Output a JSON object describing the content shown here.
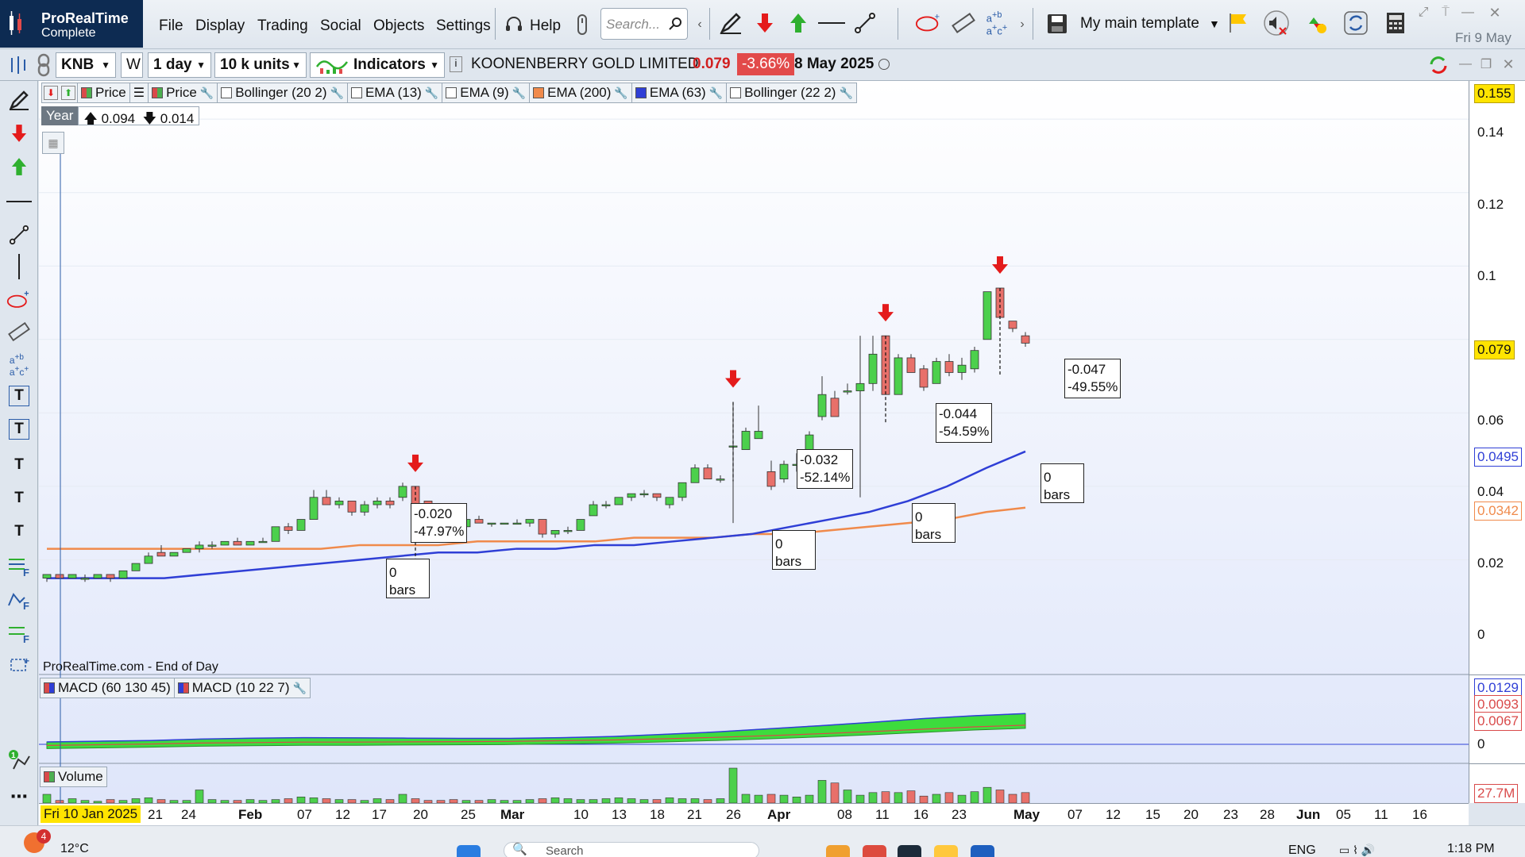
{
  "app": {
    "brand_name": "ProRealTime",
    "brand_sub": "Complete"
  },
  "menu": [
    "File",
    "Display",
    "Trading",
    "Social",
    "Objects",
    "Settings",
    "Help"
  ],
  "search": {
    "placeholder": "Search..."
  },
  "template": {
    "label": "My main template"
  },
  "top_date": "Fri 9 May",
  "toolbar2": {
    "ticker": "KNB",
    "w_label": "W",
    "period": "1 day",
    "units": "10 k units",
    "indicators": "Indicators",
    "instrument_name": "KOONENBERRY GOLD LIMITED",
    "last_price": "0.079",
    "change_pct": "-3.66%",
    "date": "8 May 2025"
  },
  "legend": [
    {
      "label": "Price",
      "color": "#d94a4a"
    },
    {
      "label": "Price",
      "color": "#4caf50"
    },
    {
      "label": "Bollinger (20 2)",
      "color": "#ffffff"
    },
    {
      "label": "EMA (13)",
      "color": "#ffffff"
    },
    {
      "label": "EMA (9)",
      "color": "#ffffff"
    },
    {
      "label": "EMA (200)",
      "color": "#f08a4b"
    },
    {
      "label": "EMA (63)",
      "color": "#2f3fd6"
    },
    {
      "label": "Bollinger (22 2)",
      "color": "#ffffff"
    }
  ],
  "year_box": {
    "label": "Year",
    "high": "0.094",
    "low": "0.014"
  },
  "source": "ProRealTime.com - End of Day",
  "y_axis": {
    "ticks": [
      "0.14",
      "0.12",
      "0.1",
      "0.06",
      "0.04",
      "0.02",
      "0"
    ],
    "badges": [
      {
        "value": "0.155",
        "bg": "#ffe400",
        "fg": "#111"
      },
      {
        "value": "0.079",
        "bg": "#ffe400",
        "fg": "#111"
      },
      {
        "value": "0.0495",
        "bg": "#ffffff",
        "fg": "#2f3fd6"
      },
      {
        "value": "0.0342",
        "bg": "#ffffff",
        "fg": "#f08a4b"
      }
    ],
    "macd_badges": [
      {
        "value": "0.0129",
        "fg": "#2f3fd6"
      },
      {
        "value": "0.0093",
        "fg": "#d94a4a"
      },
      {
        "value": "0.0067",
        "fg": "#d94a4a"
      }
    ],
    "macd_zero": "0",
    "vol_badge": "27.7M"
  },
  "annotations": [
    {
      "change": "-0.020",
      "pct": "-47.97%",
      "bars": "0 bars"
    },
    {
      "change": "-0.032",
      "pct": "-52.14%",
      "bars": "0 bars"
    },
    {
      "change": "-0.044",
      "pct": "-54.59%",
      "bars": "0 bars"
    },
    {
      "change": "-0.047",
      "pct": "-49.55%",
      "bars": "0 bars"
    }
  ],
  "macd_legend": [
    {
      "label": "MACD (60 130 45)",
      "color": "#d94a4a"
    },
    {
      "label": "MACD (10 22 7)",
      "color": "#2f3fd6"
    }
  ],
  "volume_legend": {
    "label": "Volume",
    "color": "#4caf50"
  },
  "x_axis": {
    "start": "Fri 10 Jan 2025",
    "ticks": [
      {
        "label": "21"
      },
      {
        "label": "24"
      },
      {
        "label": "Feb",
        "month": true
      },
      {
        "label": "07"
      },
      {
        "label": "12"
      },
      {
        "label": "17"
      },
      {
        "label": "20"
      },
      {
        "label": "25"
      },
      {
        "label": "Mar",
        "month": true
      },
      {
        "label": "10"
      },
      {
        "label": "13"
      },
      {
        "label": "18"
      },
      {
        "label": "21"
      },
      {
        "label": "26"
      },
      {
        "label": "Apr",
        "month": true
      },
      {
        "label": "08"
      },
      {
        "label": "11"
      },
      {
        "label": "16"
      },
      {
        "label": "23"
      },
      {
        "label": "May",
        "month": true
      },
      {
        "label": "07"
      },
      {
        "label": "12"
      },
      {
        "label": "15"
      },
      {
        "label": "20"
      },
      {
        "label": "23"
      },
      {
        "label": "28"
      },
      {
        "label": "Jun",
        "month": true
      },
      {
        "label": "05"
      },
      {
        "label": "11"
      },
      {
        "label": "16"
      }
    ]
  },
  "taskbar": {
    "weather_badge": "4",
    "temperature": "12°C",
    "search": "Search",
    "language": "ENG",
    "time": "1:18 PM"
  },
  "chart_data": {
    "type": "candlestick",
    "title": "KOONENBERRY GOLD LIMITED",
    "ylim": [
      0,
      0.155
    ],
    "ohlc": [
      [
        0.015,
        0.016,
        0.014,
        0.016
      ],
      [
        0.016,
        0.016,
        0.015,
        0.015
      ],
      [
        0.015,
        0.016,
        0.015,
        0.016
      ],
      [
        0.015,
        0.016,
        0.014,
        0.015
      ],
      [
        0.015,
        0.016,
        0.015,
        0.016
      ],
      [
        0.016,
        0.016,
        0.014,
        0.015
      ],
      [
        0.015,
        0.017,
        0.015,
        0.017
      ],
      [
        0.017,
        0.019,
        0.017,
        0.019
      ],
      [
        0.019,
        0.022,
        0.019,
        0.021
      ],
      [
        0.022,
        0.024,
        0.021,
        0.021
      ],
      [
        0.021,
        0.022,
        0.021,
        0.022
      ],
      [
        0.022,
        0.023,
        0.022,
        0.023
      ],
      [
        0.023,
        0.025,
        0.022,
        0.024
      ],
      [
        0.024,
        0.025,
        0.023,
        0.024
      ],
      [
        0.024,
        0.025,
        0.024,
        0.025
      ],
      [
        0.025,
        0.026,
        0.024,
        0.024
      ],
      [
        0.024,
        0.025,
        0.024,
        0.025
      ],
      [
        0.025,
        0.026,
        0.025,
        0.025
      ],
      [
        0.025,
        0.029,
        0.025,
        0.029
      ],
      [
        0.029,
        0.03,
        0.027,
        0.028
      ],
      [
        0.028,
        0.031,
        0.028,
        0.031
      ],
      [
        0.031,
        0.039,
        0.031,
        0.037
      ],
      [
        0.037,
        0.039,
        0.035,
        0.035
      ],
      [
        0.035,
        0.037,
        0.034,
        0.036
      ],
      [
        0.036,
        0.036,
        0.032,
        0.033
      ],
      [
        0.033,
        0.036,
        0.032,
        0.035
      ],
      [
        0.035,
        0.037,
        0.034,
        0.036
      ],
      [
        0.036,
        0.037,
        0.034,
        0.035
      ],
      [
        0.037,
        0.041,
        0.036,
        0.04
      ],
      [
        0.04,
        0.04,
        0.03,
        0.032
      ],
      [
        0.036,
        0.036,
        0.032,
        0.032
      ],
      [
        0.032,
        0.033,
        0.031,
        0.031
      ],
      [
        0.031,
        0.033,
        0.029,
        0.029
      ],
      [
        0.029,
        0.031,
        0.029,
        0.031
      ],
      [
        0.031,
        0.032,
        0.03,
        0.03
      ],
      [
        0.03,
        0.03,
        0.029,
        0.03
      ],
      [
        0.03,
        0.03,
        0.03,
        0.03
      ],
      [
        0.03,
        0.031,
        0.03,
        0.03
      ],
      [
        0.03,
        0.031,
        0.029,
        0.031
      ],
      [
        0.031,
        0.031,
        0.026,
        0.027
      ],
      [
        0.027,
        0.028,
        0.026,
        0.028
      ],
      [
        0.028,
        0.029,
        0.027,
        0.028
      ],
      [
        0.028,
        0.031,
        0.028,
        0.031
      ],
      [
        0.032,
        0.036,
        0.032,
        0.035
      ],
      [
        0.035,
        0.036,
        0.034,
        0.035
      ],
      [
        0.035,
        0.037,
        0.035,
        0.037
      ],
      [
        0.037,
        0.038,
        0.036,
        0.038
      ],
      [
        0.038,
        0.039,
        0.037,
        0.038
      ],
      [
        0.038,
        0.038,
        0.036,
        0.037
      ],
      [
        0.035,
        0.037,
        0.034,
        0.037
      ],
      [
        0.037,
        0.041,
        0.036,
        0.041
      ],
      [
        0.041,
        0.046,
        0.041,
        0.045
      ],
      [
        0.045,
        0.046,
        0.042,
        0.042
      ],
      [
        0.042,
        0.043,
        0.041,
        0.042
      ],
      [
        0.051,
        0.063,
        0.03,
        0.051
      ],
      [
        0.05,
        0.056,
        0.05,
        0.055
      ],
      [
        0.053,
        0.062,
        0.053,
        0.055
      ],
      [
        0.044,
        0.047,
        0.039,
        0.04
      ],
      [
        0.042,
        0.047,
        0.041,
        0.046
      ],
      [
        0.046,
        0.049,
        0.044,
        0.046
      ],
      [
        0.048,
        0.055,
        0.047,
        0.054
      ],
      [
        0.059,
        0.07,
        0.058,
        0.065
      ],
      [
        0.064,
        0.066,
        0.059,
        0.059
      ],
      [
        0.066,
        0.068,
        0.065,
        0.066
      ],
      [
        0.066,
        0.081,
        0.037,
        0.068
      ],
      [
        0.068,
        0.081,
        0.066,
        0.076
      ],
      [
        0.081,
        0.081,
        0.065,
        0.065
      ],
      [
        0.065,
        0.076,
        0.065,
        0.075
      ],
      [
        0.075,
        0.076,
        0.071,
        0.071
      ],
      [
        0.072,
        0.073,
        0.066,
        0.067
      ],
      [
        0.068,
        0.075,
        0.068,
        0.074
      ],
      [
        0.074,
        0.076,
        0.07,
        0.071
      ],
      [
        0.071,
        0.075,
        0.069,
        0.073
      ],
      [
        0.072,
        0.078,
        0.071,
        0.077
      ],
      [
        0.08,
        0.093,
        0.08,
        0.093
      ],
      [
        0.094,
        0.094,
        0.086,
        0.086
      ],
      [
        0.085,
        0.085,
        0.082,
        0.083
      ],
      [
        0.081,
        0.082,
        0.078,
        0.079
      ]
    ],
    "ema63": [
      0.015,
      0.015,
      0.015,
      0.015,
      0.016,
      0.017,
      0.018,
      0.019,
      0.02,
      0.021,
      0.022,
      0.022,
      0.023,
      0.023,
      0.024,
      0.024,
      0.025,
      0.026,
      0.027,
      0.029,
      0.031,
      0.033,
      0.036,
      0.04,
      0.045,
      0.0495
    ],
    "ema200": [
      0.023,
      0.023,
      0.023,
      0.023,
      0.023,
      0.023,
      0.023,
      0.023,
      0.024,
      0.024,
      0.024,
      0.025,
      0.025,
      0.025,
      0.025,
      0.026,
      0.026,
      0.026,
      0.027,
      0.027,
      0.028,
      0.029,
      0.03,
      0.031,
      0.033,
      0.0342
    ],
    "macd_fill_top": [
      0.001,
      0.0013,
      0.0016,
      0.0022,
      0.0026,
      0.0028,
      0.0027,
      0.0026,
      0.0025,
      0.0025,
      0.0028,
      0.0033,
      0.0042,
      0.0052,
      0.0065,
      0.0078,
      0.0092,
      0.0108,
      0.012,
      0.0129
    ],
    "macd_fill_bottom": [
      -0.0018,
      -0.0015,
      -0.0012,
      -0.0008,
      -0.0006,
      -0.0004,
      -0.0004,
      -0.0003,
      -0.0002,
      -0.0001,
      0.0002,
      0.0005,
      0.001,
      0.0016,
      0.0023,
      0.0031,
      0.004,
      0.005,
      0.006,
      0.0067
    ],
    "volume": [
      1,
      0.3,
      0.5,
      0.3,
      0.2,
      0.4,
      0.3,
      0.5,
      0.6,
      0.4,
      0.3,
      0.3,
      1.5,
      0.4,
      0.3,
      0.3,
      0.4,
      0.3,
      0.4,
      0.5,
      0.7,
      0.6,
      0.5,
      0.4,
      0.4,
      0.3,
      0.5,
      0.4,
      1.0,
      0.5,
      0.3,
      0.3,
      0.4,
      0.3,
      0.3,
      0.4,
      0.3,
      0.3,
      0.4,
      0.5,
      0.6,
      0.5,
      0.4,
      0.4,
      0.5,
      0.6,
      0.5,
      0.4,
      0.4,
      0.6,
      0.5,
      0.5,
      0.4,
      0.5,
      4.0,
      1.0,
      0.9,
      1.0,
      0.9,
      0.7,
      0.9,
      2.6,
      2.3,
      1.5,
      0.9,
      1.2,
      1.3,
      1.2,
      1.4,
      0.8,
      1.0,
      1.2,
      0.9,
      1.3,
      1.8,
      1.5,
      1.0,
      1.2
    ],
    "sell_arrows_at": [
      29,
      54,
      66,
      75
    ]
  }
}
